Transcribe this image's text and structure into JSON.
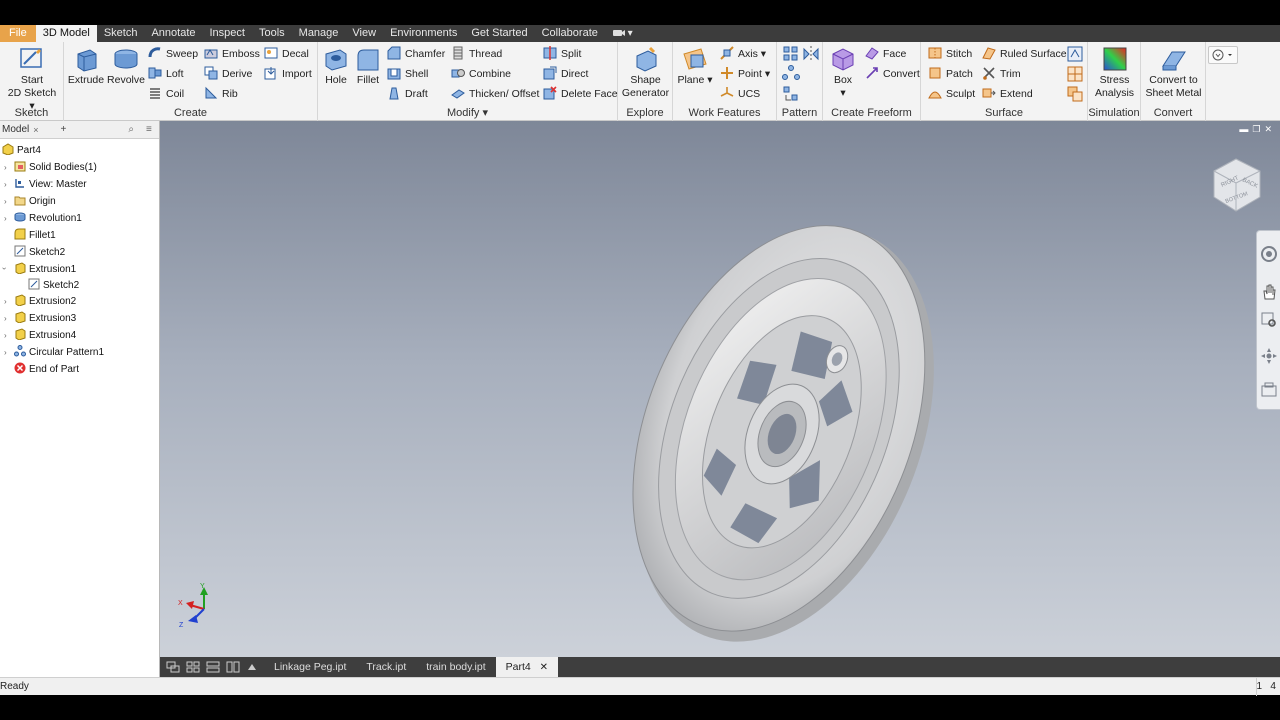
{
  "tabs": [
    "File",
    "3D Model",
    "Sketch",
    "Annotate",
    "Inspect",
    "Tools",
    "Manage",
    "View",
    "Environments",
    "Get Started",
    "Collaborate"
  ],
  "tab_extra": "▾",
  "ribbon": {
    "sketch": {
      "title": "Sketch",
      "start": "Start",
      "sketch2d": "2D Sketch"
    },
    "create": {
      "title": "Create",
      "extrude": "Extrude",
      "revolve": "Revolve",
      "sweep": "Sweep",
      "loft": "Loft",
      "coil": "Coil",
      "emboss": "Emboss",
      "derive": "Derive",
      "rib": "Rib",
      "decal": "Decal",
      "import": "Import"
    },
    "modify": {
      "title": "Modify ▾",
      "hole": "Hole",
      "fillet": "Fillet",
      "chamfer": "Chamfer",
      "shell": "Shell",
      "draft": "Draft",
      "thread": "Thread",
      "combine": "Combine",
      "thicken": "Thicken/ Offset",
      "split": "Split",
      "direct": "Direct",
      "delete_face": "Delete Face"
    },
    "explore": {
      "title": "Explore",
      "shape": "Shape",
      "generator": "Generator"
    },
    "work": {
      "title": "Work Features",
      "plane": "Plane",
      "axis": "Axis ▾",
      "point": "Point ▾",
      "ucs": "UCS"
    },
    "pattern": {
      "title": "Pattern"
    },
    "freeform": {
      "title": "Create Freeform",
      "box": "Box",
      "face": "Face",
      "convert": "Convert"
    },
    "surface": {
      "title": "Surface",
      "stitch": "Stitch",
      "patch": "Patch",
      "sculpt": "Sculpt",
      "ruled": "Ruled Surface",
      "trim": "Trim",
      "extend": "Extend"
    },
    "simulation": {
      "title": "Simulation",
      "stress": "Stress",
      "analysis": "Analysis"
    },
    "convert": {
      "title": "Convert",
      "to": "Convert to",
      "sheet": "Sheet Metal"
    }
  },
  "browser": {
    "title": "Model",
    "close": "×",
    "plus": "+",
    "search": "⌕",
    "menu": "≡",
    "items": [
      "Part4",
      "Solid Bodies(1)",
      "View: Master",
      "Origin",
      "Revolution1",
      "Fillet1",
      "Sketch2",
      "Extrusion1",
      "Sketch2",
      "Extrusion2",
      "Extrusion3",
      "Extrusion4",
      "Circular Pattern1",
      "End of Part"
    ]
  },
  "doc_tabs": [
    "Linkage Peg.ipt",
    "Track.ipt",
    "train body.ipt",
    "Part4"
  ],
  "doc_close": "✕",
  "status": {
    "left": "Ready",
    "right": "1   4"
  },
  "viewcube": {
    "left": "RIGHT",
    "right": "BACK",
    "bottom": "BOTTOM"
  },
  "triad": {
    "x": "X",
    "y": "Y",
    "z": "Z"
  },
  "colors": {
    "file_tab": "#e8a34a",
    "tab_bar": "#3c3c3c",
    "ribbon": "#f3f3f3",
    "viewport_top": "#7e8798",
    "viewport_bottom": "#ccd1d9",
    "axis_x": "#d42020",
    "axis_y": "#20a020",
    "axis_z": "#2040d0"
  }
}
